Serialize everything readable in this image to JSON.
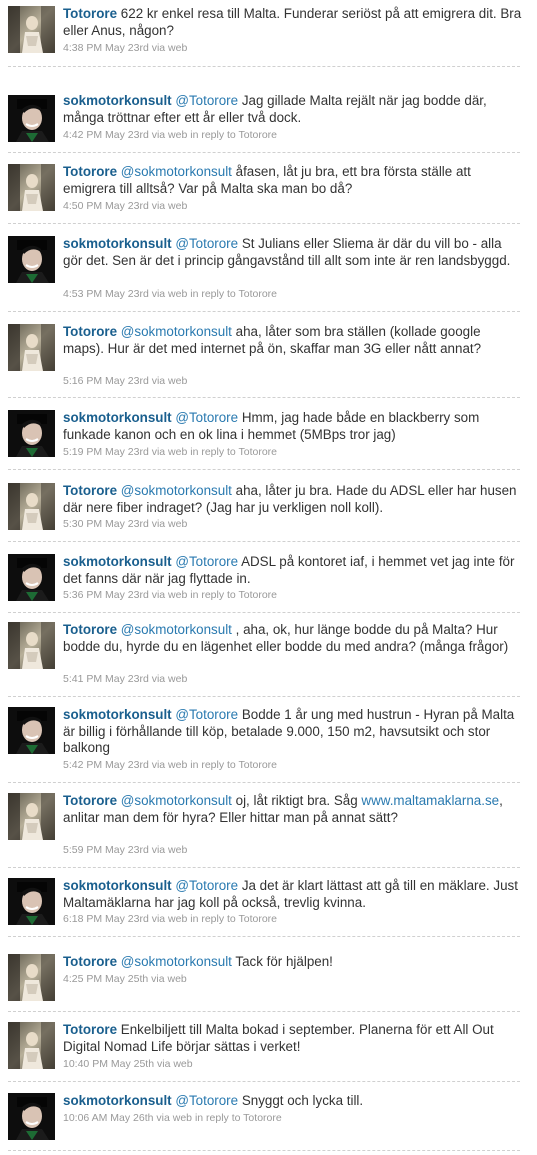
{
  "tweets": [
    {
      "user": "Totorore",
      "mention": "",
      "text": "622 kr enkel resa till Malta. Funderar seriöst på att emigrera dit. Bra eller Anus, någon?",
      "time": "4:38 PM May 23rd",
      "via": "via web",
      "reply": ""
    },
    {
      "user": "sokmotorkonsult",
      "mention": "@Totorore",
      "text": "Jag gillade Malta rejält när jag bodde där, många tröttnar efter ett år eller två dock.",
      "time": "4:42 PM May 23rd",
      "via": "via web",
      "reply": "in reply to Totorore"
    },
    {
      "user": "Totorore",
      "mention": "@sokmotorkonsult",
      "text": "åfasen, låt ju bra, ett bra första ställe att emigrera till alltså? Var på Malta ska man bo då?",
      "time": "4:50 PM May 23rd",
      "via": "via web",
      "reply": ""
    },
    {
      "user": "sokmotorkonsult",
      "mention": "@Totorore",
      "text": "St Julians eller Sliema är där du vill bo - alla gör det. Sen är det i princip gångavstånd till allt som inte är ren landsbyggd.",
      "time": "4:53 PM May 23rd",
      "via": "via web",
      "reply": "in reply to Totorore"
    },
    {
      "user": "Totorore",
      "mention": "@sokmotorkonsult",
      "text": "aha, låter som bra ställen (kollade google maps). Hur är det med internet på ön, skaffar man 3G eller nått annat?",
      "time": "5:16 PM May 23rd",
      "via": "via web",
      "reply": ""
    },
    {
      "user": "sokmotorkonsult",
      "mention": "@Totorore",
      "text": "Hmm, jag hade både en blackberry som funkade kanon och en ok lina i hemmet (5MBps tror jag)",
      "time": "5:19 PM May 23rd",
      "via": "via web",
      "reply": "in reply to Totorore"
    },
    {
      "user": "Totorore",
      "mention": "@sokmotorkonsult",
      "text": "aha, låter ju bra. Hade du ADSL eller har husen där nere fiber indraget? (Jag har ju verkligen noll koll).",
      "time": "5:30 PM May 23rd",
      "via": "via web",
      "reply": ""
    },
    {
      "user": "sokmotorkonsult",
      "mention": "@Totorore",
      "text": "ADSL på kontoret iaf, i hemmet vet jag inte för det fanns där när jag flyttade in.",
      "time": "5:36 PM May 23rd",
      "via": "via web",
      "reply": "in reply to Totorore"
    },
    {
      "user": "Totorore",
      "mention": "@sokmotorkonsult",
      "text": ", aha, ok, hur länge bodde du på Malta? Hur bodde du, hyrde du en lägenhet eller bodde du med andra? (många frågor)",
      "time": "5:41 PM May 23rd",
      "via": "via web",
      "reply": ""
    },
    {
      "user": "sokmotorkonsult",
      "mention": "@Totorore",
      "text": "Bodde 1 år ung med hustrun - Hyran på Malta är billig i förhållande till köp, betalade 9.000, 150 m2, havsutsikt och stor balkong",
      "time": "5:42 PM May 23rd",
      "via": "via web",
      "reply": "in reply to Totorore"
    },
    {
      "user": "Totorore",
      "mention": "@sokmotorkonsult",
      "text": "oj, låt riktigt bra. Såg",
      "link": "www.maltamaklarna.se",
      "text2": ", anlitar man dem för hyra? Eller hittar man på annat sätt?",
      "time": "5:59 PM May 23rd",
      "via": "via web",
      "reply": ""
    },
    {
      "user": "sokmotorkonsult",
      "mention": "@Totorore",
      "text": "Ja det är klart lättast att gå till en mäklare. Just Maltamäklarna har jag koll på också, trevlig kvinna.",
      "time": "6:18 PM May 23rd",
      "via": "via web",
      "reply": "in reply to Totorore"
    },
    {
      "user": "Totorore",
      "mention": "@sokmotorkonsult",
      "text": "Tack för hjälpen!",
      "time": "4:25 PM May 25th",
      "via": "via web",
      "reply": ""
    },
    {
      "user": "Totorore",
      "mention": "",
      "text": "Enkelbiljett till Malta bokad i september. Planerna för ett All Out Digital Nomad Life börjar sättas i verket!",
      "time": "10:40 PM May 25th",
      "via": "via web",
      "reply": ""
    },
    {
      "user": "sokmotorkonsult",
      "mention": "@Totorore",
      "text": "Snyggt och lycka till.",
      "time": "10:06 AM May 26th",
      "via": "via web",
      "reply": "in reply to Totorore"
    }
  ],
  "colors": {
    "username": "#1a5f8e",
    "link": "#2a7ab0",
    "text": "#333333",
    "meta": "#999999"
  }
}
